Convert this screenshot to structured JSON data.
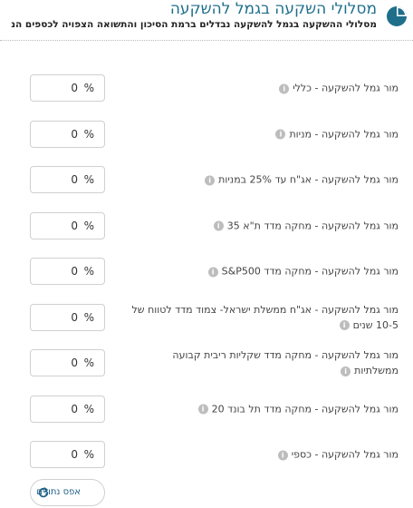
{
  "header": {
    "title": "מסלולי השקעה בגמל להשקעה",
    "subtitle": "מסלולי ההשקעה בגמל להשקעה נבדלים ברמת הסיכון והתשואה הצפויה לכספים הנ",
    "icon": "pie-chart-icon",
    "accent_color": "#1f6f8b"
  },
  "tracks": [
    {
      "label": "מור גמל להשקעה - כללי",
      "value": "0",
      "unit": "%"
    },
    {
      "label": "מור גמל להשקעה - מניות",
      "value": "0",
      "unit": "%"
    },
    {
      "label": "מור גמל להשקעה - אג\"ח עד 25% במניות",
      "value": "0",
      "unit": "%"
    },
    {
      "label": "מור גמל להשקעה - מחקה מדד ת\"א 35",
      "value": "0",
      "unit": "%"
    },
    {
      "label": "מור גמל להשקעה - מחקה מדד S&P500",
      "value": "0",
      "unit": "%"
    },
    {
      "label": "מור גמל להשקעה - אג\"ח ממשלת ישראל- צמוד מדד לטווח של 10-5 שנים",
      "value": "0",
      "unit": "%"
    },
    {
      "label": "מור גמל להשקעה - מחקה מדד שקליות ריבית קבועה ממשלתיות",
      "value": "0",
      "unit": "%"
    },
    {
      "label": "מור גמל להשקעה - מחקה מדד תל בונד 20",
      "value": "0",
      "unit": "%"
    },
    {
      "label": "מור גמל להשקעה - כספי",
      "value": "0",
      "unit": "%"
    }
  ],
  "info_icon_glyph": "i",
  "reset": {
    "label": "אפס נתונים",
    "icon": "refresh-icon",
    "color": "#1f5f86"
  }
}
